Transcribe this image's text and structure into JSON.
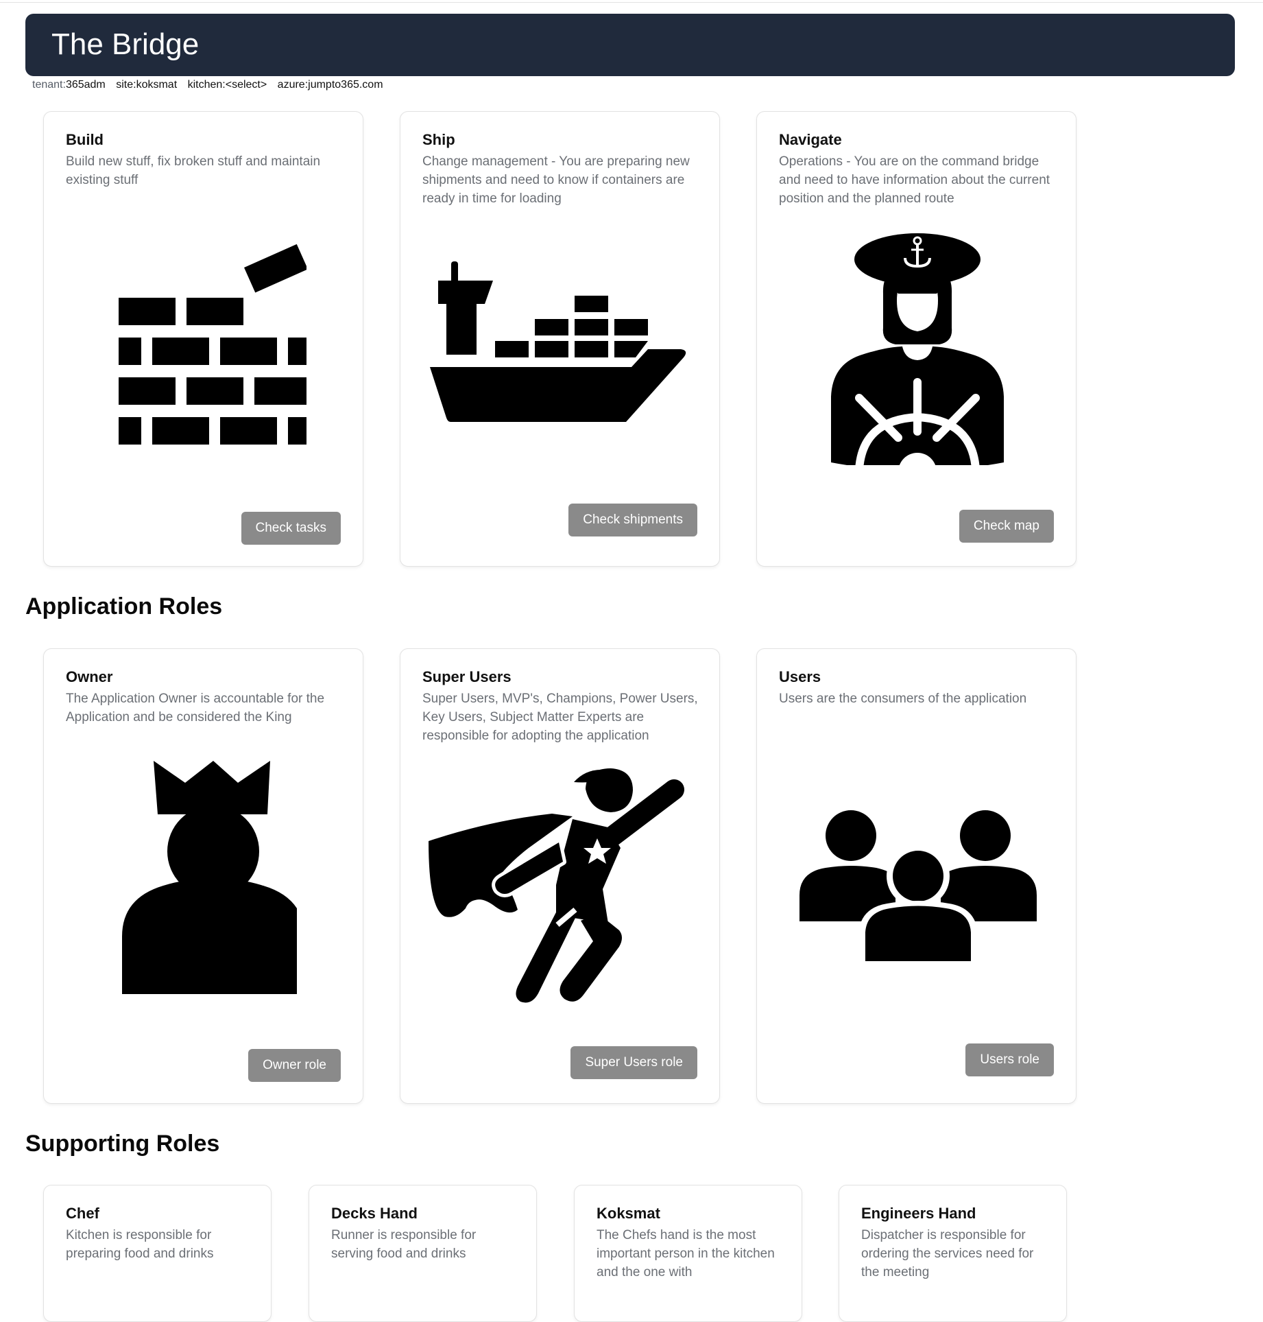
{
  "header": {
    "title": "The Bridge"
  },
  "meta": {
    "tenant_label": "tenant:",
    "tenant_value": "365adm",
    "site": "site:koksmat",
    "kitchen": "kitchen:<select>",
    "azure": "azure:jumpto365.com"
  },
  "colors": {
    "header_bg": "#202a3c",
    "button_bg": "#8a8a8a",
    "description": "#6b6f75"
  },
  "main_cards": [
    {
      "title": "Build",
      "description": "Build new stuff, fix broken stuff and maintain existing stuff",
      "button": "Check tasks",
      "icon": "brick-wall-icon"
    },
    {
      "title": "Ship",
      "description": "Change management - You are preparing new shipments and need to know if containers are ready in time for loading",
      "button": "Check shipments",
      "icon": "cargo-ship-icon"
    },
    {
      "title": "Navigate",
      "description": "Operations - You are on the command bridge and need to have information about the current position and the planned route",
      "button": "Check map",
      "icon": "captain-icon"
    }
  ],
  "application_roles": {
    "heading": "Application Roles",
    "cards": [
      {
        "title": "Owner",
        "description": "The Application Owner is accountable for the Application and be considered the King",
        "button": "Owner role",
        "icon": "king-icon"
      },
      {
        "title": "Super Users",
        "description": "Super Users, MVP's, Champions, Power Users, Key Users, Subject Matter Experts are responsible for adopting the application",
        "button": "Super Users role",
        "icon": "superhero-icon"
      },
      {
        "title": "Users",
        "description": "Users are the consumers of the application",
        "button": "Users role",
        "icon": "users-group-icon"
      }
    ]
  },
  "supporting_roles": {
    "heading": "Supporting Roles",
    "cards": [
      {
        "title": "Chef",
        "description": "Kitchen is responsible for preparing food and drinks"
      },
      {
        "title": "Decks Hand",
        "description": "Runner is responsible for serving food and drinks"
      },
      {
        "title": "Koksmat",
        "description": "The Chefs hand is the most important person in the kitchen and the one with"
      },
      {
        "title": "Engineers Hand",
        "description": "Dispatcher is responsible for ordering the services need for the meeting"
      }
    ]
  }
}
